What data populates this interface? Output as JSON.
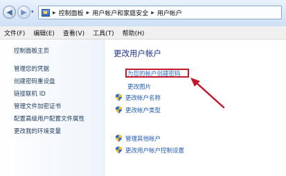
{
  "breadcrumb": {
    "items": [
      "控制面板",
      "用户帐户和家庭安全",
      "用户帐户"
    ]
  },
  "menu": [
    "文件(F)",
    "编辑(E)",
    "查看(V)",
    "工具(T)",
    "帮助(H)"
  ],
  "sidebar": {
    "items": [
      "控制面板主页",
      "管理您的凭据",
      "创建密码重设盘",
      "链接联机 ID",
      "管理文件加密证书",
      "配置高级用户配置文件属性",
      "更改我的环境变量"
    ]
  },
  "main": {
    "title": "更改用户帐户",
    "links": {
      "create_password": "为您的帐户创建密码",
      "change_picture": "更改图片",
      "change_name": "更改帐户名称",
      "change_type": "更改帐户类型",
      "manage_other": "管理其他帐户",
      "uac_settings": "更改用户帐户控制设置"
    }
  },
  "colors": {
    "highlight_box": "#c2182b",
    "arrow": "#c2182b",
    "link": "#1f5bb5"
  }
}
